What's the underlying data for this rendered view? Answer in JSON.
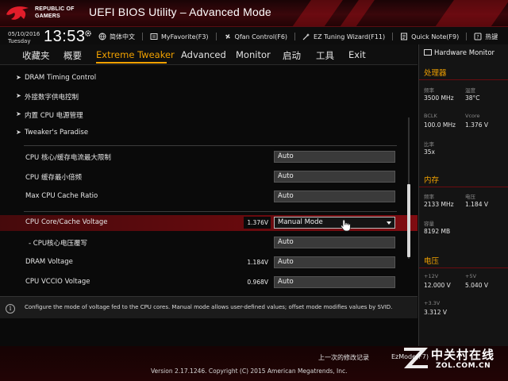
{
  "header": {
    "brand_line1": "REPUBLIC OF",
    "brand_line2": "GAMERS",
    "title": "UEFI BIOS Utility – Advanced Mode"
  },
  "infobar": {
    "date": "05/10/2016",
    "weekday": "Tuesday",
    "time": "13:53",
    "tools": [
      {
        "label": "简体中文",
        "icon": "globe-icon"
      },
      {
        "label": "MyFavorite(F3)",
        "icon": "favorite-icon"
      },
      {
        "label": "Qfan Control(F6)",
        "icon": "fan-icon"
      },
      {
        "label": "EZ Tuning Wizard(F11)",
        "icon": "wizard-icon"
      },
      {
        "label": "Quick Note(F9)",
        "icon": "note-icon"
      },
      {
        "label": "热键",
        "icon": "hotkey-icon"
      }
    ]
  },
  "menu": {
    "items": [
      "收藏夹",
      "概要",
      "Extreme Tweaker",
      "Advanced",
      "Monitor",
      "启动",
      "工具",
      "Exit"
    ],
    "active": "Extreme Tweaker"
  },
  "main": {
    "submenus": [
      "DRAM Timing Control",
      "外接数字供电控制",
      "内置 CPU 电源管理",
      "Tweaker's Paradise"
    ],
    "settings": [
      {
        "label": "CPU 核心/缓存电流最大限制",
        "value": "Auto"
      },
      {
        "label": "CPU 缓存最小倍频",
        "value": "Auto"
      },
      {
        "label": "Max CPU Cache Ratio",
        "value": "Auto"
      }
    ],
    "voltage": {
      "label": "CPU Core/Cache Voltage",
      "reading": "1.376V",
      "value": "Manual Mode"
    },
    "override": {
      "label": "- CPU核心电压覆写",
      "value": "Auto"
    },
    "dram_voltage": {
      "label": "DRAM Voltage",
      "reading": "1.184V",
      "value": "Auto"
    },
    "vccio": {
      "label": "CPU VCCIO Voltage",
      "reading": "0.968V",
      "value": "Auto"
    }
  },
  "help": {
    "text": "Configure the mode of voltage fed to the CPU cores. Manual mode allows user-defined values; offset mode modifies values by SVID."
  },
  "hwmon": {
    "title": "Hardware Monitor",
    "cpu": {
      "title": "处理器",
      "freq_label": "频率",
      "freq": "3500 MHz",
      "temp_label": "温度",
      "temp": "38°C",
      "bclk_label": "BCLK",
      "bclk": "100.0 MHz",
      "vcore_label": "Vcore",
      "vcore": "1.376 V",
      "ratio_label": "比率",
      "ratio": "35x"
    },
    "memory": {
      "title": "内存",
      "freq_label": "频率",
      "freq": "2133 MHz",
      "volt_label": "电压",
      "volt": "1.184 V",
      "cap_label": "容量",
      "cap": "8192 MB"
    },
    "voltage": {
      "title": "电压",
      "v12_label": "+12V",
      "v12": "12.000 V",
      "v5_label": "+5V",
      "v5": "5.040 V",
      "v33_label": "+3.3V",
      "v33": "3.312 V"
    }
  },
  "footer": {
    "last_modified": "上一次的修改记录",
    "ezmode": "EzMode(F7)",
    "copyright": "Version 2.17.1246. Copyright (C) 2015 American Megatrends, Inc."
  },
  "watermark": {
    "cn": "中关村在线",
    "en": "ZOL.COM.CN"
  },
  "colors": {
    "accent": "#f0a000",
    "selected_row": "#7a0a0e",
    "header_red": "#3a070b"
  }
}
